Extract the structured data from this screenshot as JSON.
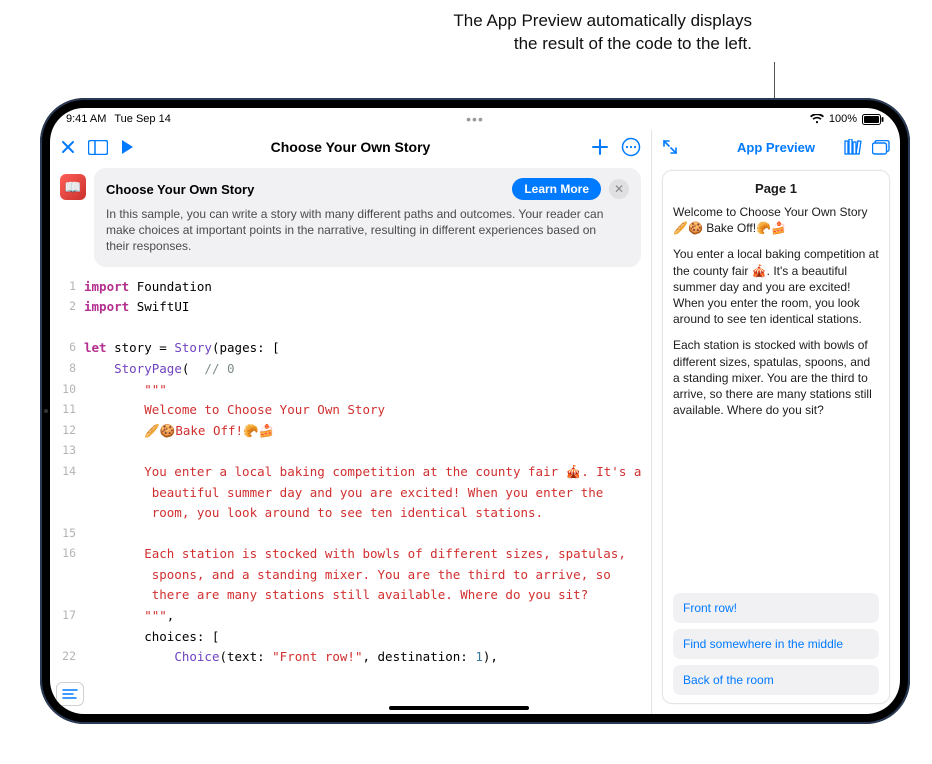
{
  "annotation": {
    "line1": "The App Preview automatically displays",
    "line2": "the result of the code to the left."
  },
  "statusbar": {
    "time": "9:41 AM",
    "date": "Tue Sep 14",
    "battery": "100%"
  },
  "editor": {
    "title": "Choose Your Own Story",
    "banner": {
      "title": "Choose Your Own Story",
      "learn_more": "Learn More",
      "desc": "In this sample, you can write a story with many different paths and outcomes. Your reader can make choices at important points in the narrative, resulting in different experiences based on their responses."
    },
    "code": {
      "gutter": [
        "1",
        "2",
        "",
        "6",
        "8",
        "10",
        "11",
        "12",
        "13",
        "14",
        "",
        "",
        "15",
        "16",
        "",
        "",
        "17",
        "",
        "22"
      ],
      "lines": [
        {
          "segs": [
            {
              "t": "import ",
              "c": "kw"
            },
            {
              "t": "Foundation",
              "c": ""
            }
          ]
        },
        {
          "segs": [
            {
              "t": "import ",
              "c": "kw"
            },
            {
              "t": "SwiftUI",
              "c": ""
            }
          ]
        },
        {
          "segs": [
            {
              "t": "",
              "c": ""
            }
          ]
        },
        {
          "segs": [
            {
              "t": "let ",
              "c": "kw"
            },
            {
              "t": "story = ",
              "c": ""
            },
            {
              "t": "Story",
              "c": "type"
            },
            {
              "t": "(pages: [",
              "c": ""
            }
          ]
        },
        {
          "segs": [
            {
              "t": "    ",
              "c": ""
            },
            {
              "t": "StoryPage",
              "c": "type"
            },
            {
              "t": "( ",
              "c": ""
            },
            {
              "t": " // 0",
              "c": "cmt"
            }
          ]
        },
        {
          "segs": [
            {
              "t": "        \"\"\"",
              "c": "str"
            }
          ]
        },
        {
          "segs": [
            {
              "t": "        Welcome to Choose Your Own Story",
              "c": "str"
            }
          ]
        },
        {
          "segs": [
            {
              "t": "        🥖🍪Bake Off!🥐🍰",
              "c": "str"
            }
          ]
        },
        {
          "segs": [
            {
              "t": "",
              "c": ""
            }
          ]
        },
        {
          "segs": [
            {
              "t": "        You enter a local baking competition at the county fair 🎪. It's a",
              "c": "str"
            }
          ]
        },
        {
          "segs": [
            {
              "t": "         beautiful summer day and you are excited! When you enter the",
              "c": "str"
            }
          ]
        },
        {
          "segs": [
            {
              "t": "         room, you look around to see ten identical stations.",
              "c": "str"
            }
          ]
        },
        {
          "segs": [
            {
              "t": "",
              "c": ""
            }
          ]
        },
        {
          "segs": [
            {
              "t": "        Each station is stocked with bowls of different sizes, spatulas,",
              "c": "str"
            }
          ]
        },
        {
          "segs": [
            {
              "t": "         spoons, and a standing mixer. You are the third to arrive, so",
              "c": "str"
            }
          ]
        },
        {
          "segs": [
            {
              "t": "         there are many stations still available. Where do you sit?",
              "c": "str"
            }
          ]
        },
        {
          "segs": [
            {
              "t": "        \"\"\"",
              "c": "str"
            },
            {
              "t": ",",
              "c": ""
            }
          ]
        },
        {
          "segs": [
            {
              "t": "        choices: [",
              "c": ""
            }
          ]
        },
        {
          "segs": [
            {
              "t": "            ",
              "c": ""
            },
            {
              "t": "Choice",
              "c": "type"
            },
            {
              "t": "(text: ",
              "c": ""
            },
            {
              "t": "\"Front row!\"",
              "c": "str"
            },
            {
              "t": ", destination: ",
              "c": ""
            },
            {
              "t": "1",
              "c": "fn"
            },
            {
              "t": "),",
              "c": ""
            }
          ]
        }
      ]
    }
  },
  "preview": {
    "title": "App Preview",
    "page_title": "Page 1",
    "paragraphs": [
      "Welcome to Choose Your Own Story 🥖🍪 Bake Off!🥐🍰",
      "You enter a local baking competition at the county fair 🎪. It's a beautiful summer day and you are excited! When you enter the room, you look around to see ten identical stations.",
      "Each station is stocked with bowls of different sizes, spatulas, spoons, and a standing mixer. You are the third to arrive, so there are many stations still available. Where do you sit?"
    ],
    "choices": [
      "Front row!",
      "Find somewhere in the middle",
      "Back of the room"
    ]
  }
}
